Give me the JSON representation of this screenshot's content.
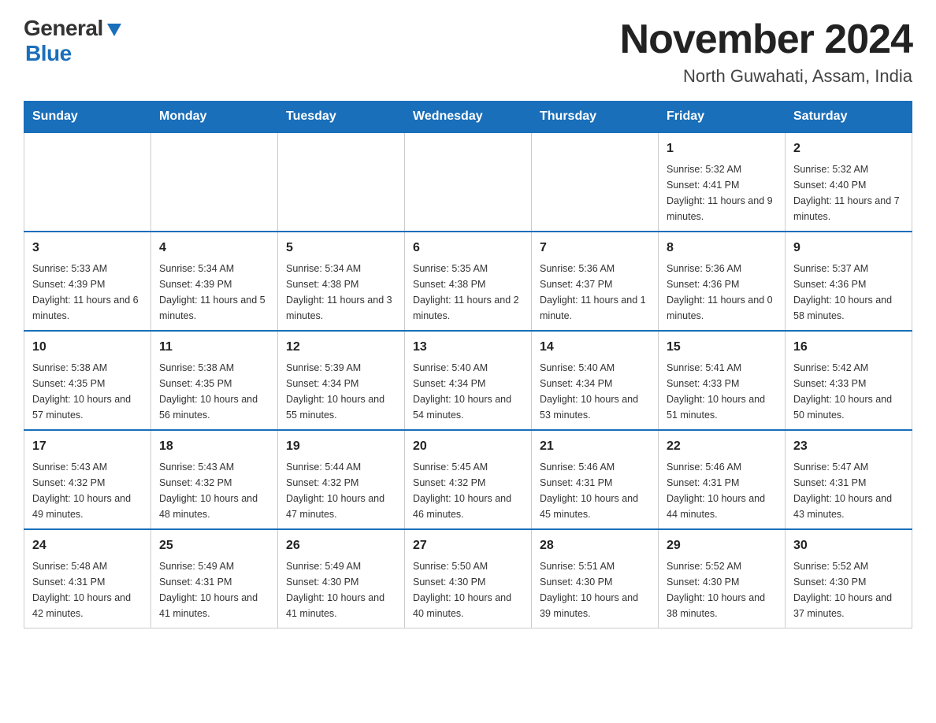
{
  "header": {
    "logo": {
      "general": "General",
      "blue": "Blue",
      "triangle": "▶"
    },
    "title": "November 2024",
    "subtitle": "North Guwahati, Assam, India"
  },
  "calendar": {
    "days_of_week": [
      "Sunday",
      "Monday",
      "Tuesday",
      "Wednesday",
      "Thursday",
      "Friday",
      "Saturday"
    ],
    "weeks": [
      [
        {
          "day": "",
          "info": ""
        },
        {
          "day": "",
          "info": ""
        },
        {
          "day": "",
          "info": ""
        },
        {
          "day": "",
          "info": ""
        },
        {
          "day": "",
          "info": ""
        },
        {
          "day": "1",
          "info": "Sunrise: 5:32 AM\nSunset: 4:41 PM\nDaylight: 11 hours and 9 minutes."
        },
        {
          "day": "2",
          "info": "Sunrise: 5:32 AM\nSunset: 4:40 PM\nDaylight: 11 hours and 7 minutes."
        }
      ],
      [
        {
          "day": "3",
          "info": "Sunrise: 5:33 AM\nSunset: 4:39 PM\nDaylight: 11 hours and 6 minutes."
        },
        {
          "day": "4",
          "info": "Sunrise: 5:34 AM\nSunset: 4:39 PM\nDaylight: 11 hours and 5 minutes."
        },
        {
          "day": "5",
          "info": "Sunrise: 5:34 AM\nSunset: 4:38 PM\nDaylight: 11 hours and 3 minutes."
        },
        {
          "day": "6",
          "info": "Sunrise: 5:35 AM\nSunset: 4:38 PM\nDaylight: 11 hours and 2 minutes."
        },
        {
          "day": "7",
          "info": "Sunrise: 5:36 AM\nSunset: 4:37 PM\nDaylight: 11 hours and 1 minute."
        },
        {
          "day": "8",
          "info": "Sunrise: 5:36 AM\nSunset: 4:36 PM\nDaylight: 11 hours and 0 minutes."
        },
        {
          "day": "9",
          "info": "Sunrise: 5:37 AM\nSunset: 4:36 PM\nDaylight: 10 hours and 58 minutes."
        }
      ],
      [
        {
          "day": "10",
          "info": "Sunrise: 5:38 AM\nSunset: 4:35 PM\nDaylight: 10 hours and 57 minutes."
        },
        {
          "day": "11",
          "info": "Sunrise: 5:38 AM\nSunset: 4:35 PM\nDaylight: 10 hours and 56 minutes."
        },
        {
          "day": "12",
          "info": "Sunrise: 5:39 AM\nSunset: 4:34 PM\nDaylight: 10 hours and 55 minutes."
        },
        {
          "day": "13",
          "info": "Sunrise: 5:40 AM\nSunset: 4:34 PM\nDaylight: 10 hours and 54 minutes."
        },
        {
          "day": "14",
          "info": "Sunrise: 5:40 AM\nSunset: 4:34 PM\nDaylight: 10 hours and 53 minutes."
        },
        {
          "day": "15",
          "info": "Sunrise: 5:41 AM\nSunset: 4:33 PM\nDaylight: 10 hours and 51 minutes."
        },
        {
          "day": "16",
          "info": "Sunrise: 5:42 AM\nSunset: 4:33 PM\nDaylight: 10 hours and 50 minutes."
        }
      ],
      [
        {
          "day": "17",
          "info": "Sunrise: 5:43 AM\nSunset: 4:32 PM\nDaylight: 10 hours and 49 minutes."
        },
        {
          "day": "18",
          "info": "Sunrise: 5:43 AM\nSunset: 4:32 PM\nDaylight: 10 hours and 48 minutes."
        },
        {
          "day": "19",
          "info": "Sunrise: 5:44 AM\nSunset: 4:32 PM\nDaylight: 10 hours and 47 minutes."
        },
        {
          "day": "20",
          "info": "Sunrise: 5:45 AM\nSunset: 4:32 PM\nDaylight: 10 hours and 46 minutes."
        },
        {
          "day": "21",
          "info": "Sunrise: 5:46 AM\nSunset: 4:31 PM\nDaylight: 10 hours and 45 minutes."
        },
        {
          "day": "22",
          "info": "Sunrise: 5:46 AM\nSunset: 4:31 PM\nDaylight: 10 hours and 44 minutes."
        },
        {
          "day": "23",
          "info": "Sunrise: 5:47 AM\nSunset: 4:31 PM\nDaylight: 10 hours and 43 minutes."
        }
      ],
      [
        {
          "day": "24",
          "info": "Sunrise: 5:48 AM\nSunset: 4:31 PM\nDaylight: 10 hours and 42 minutes."
        },
        {
          "day": "25",
          "info": "Sunrise: 5:49 AM\nSunset: 4:31 PM\nDaylight: 10 hours and 41 minutes."
        },
        {
          "day": "26",
          "info": "Sunrise: 5:49 AM\nSunset: 4:30 PM\nDaylight: 10 hours and 41 minutes."
        },
        {
          "day": "27",
          "info": "Sunrise: 5:50 AM\nSunset: 4:30 PM\nDaylight: 10 hours and 40 minutes."
        },
        {
          "day": "28",
          "info": "Sunrise: 5:51 AM\nSunset: 4:30 PM\nDaylight: 10 hours and 39 minutes."
        },
        {
          "day": "29",
          "info": "Sunrise: 5:52 AM\nSunset: 4:30 PM\nDaylight: 10 hours and 38 minutes."
        },
        {
          "day": "30",
          "info": "Sunrise: 5:52 AM\nSunset: 4:30 PM\nDaylight: 10 hours and 37 minutes."
        }
      ]
    ]
  }
}
